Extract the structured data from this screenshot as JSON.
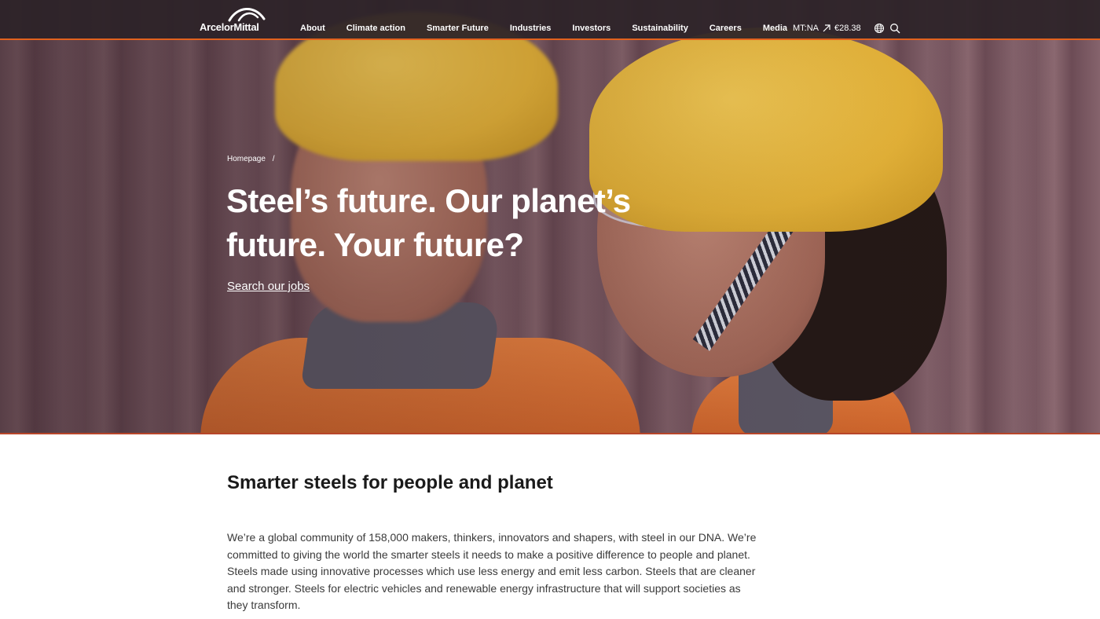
{
  "header": {
    "logo_text": "ArcelorMittal",
    "nav": [
      "About",
      "Climate action",
      "Smarter Future",
      "Industries",
      "Investors",
      "Sustainability",
      "Careers",
      "Media"
    ],
    "ticker_symbol": "MT:NA",
    "ticker_price": "€28.38",
    "ticker_trend_icon": "arrow-up-right-icon",
    "icons": [
      "globe-icon",
      "search-icon"
    ]
  },
  "hero": {
    "breadcrumb_home": "Homepage",
    "breadcrumb_sep": "/",
    "title": "Steel’s future. Our planet’s future. Your future?",
    "link": "Search our jobs"
  },
  "content": {
    "title": "Smarter steels for people and planet",
    "body": "We’re a global community of 158,000 makers, thinkers, innovators and shapers, with steel in our DNA. We’re committed to giving the world the smarter steels it needs to make a positive difference to people and planet. Steels made using innovative processes which use less energy and emit less carbon. Steels that are cleaner and stronger. Steels for electric vehicles and renewable energy infrastructure that will support societies as they transform."
  },
  "colors": {
    "header_bg": "#2c2228",
    "accent": "#e2621e",
    "text": "#1e1e1e"
  }
}
